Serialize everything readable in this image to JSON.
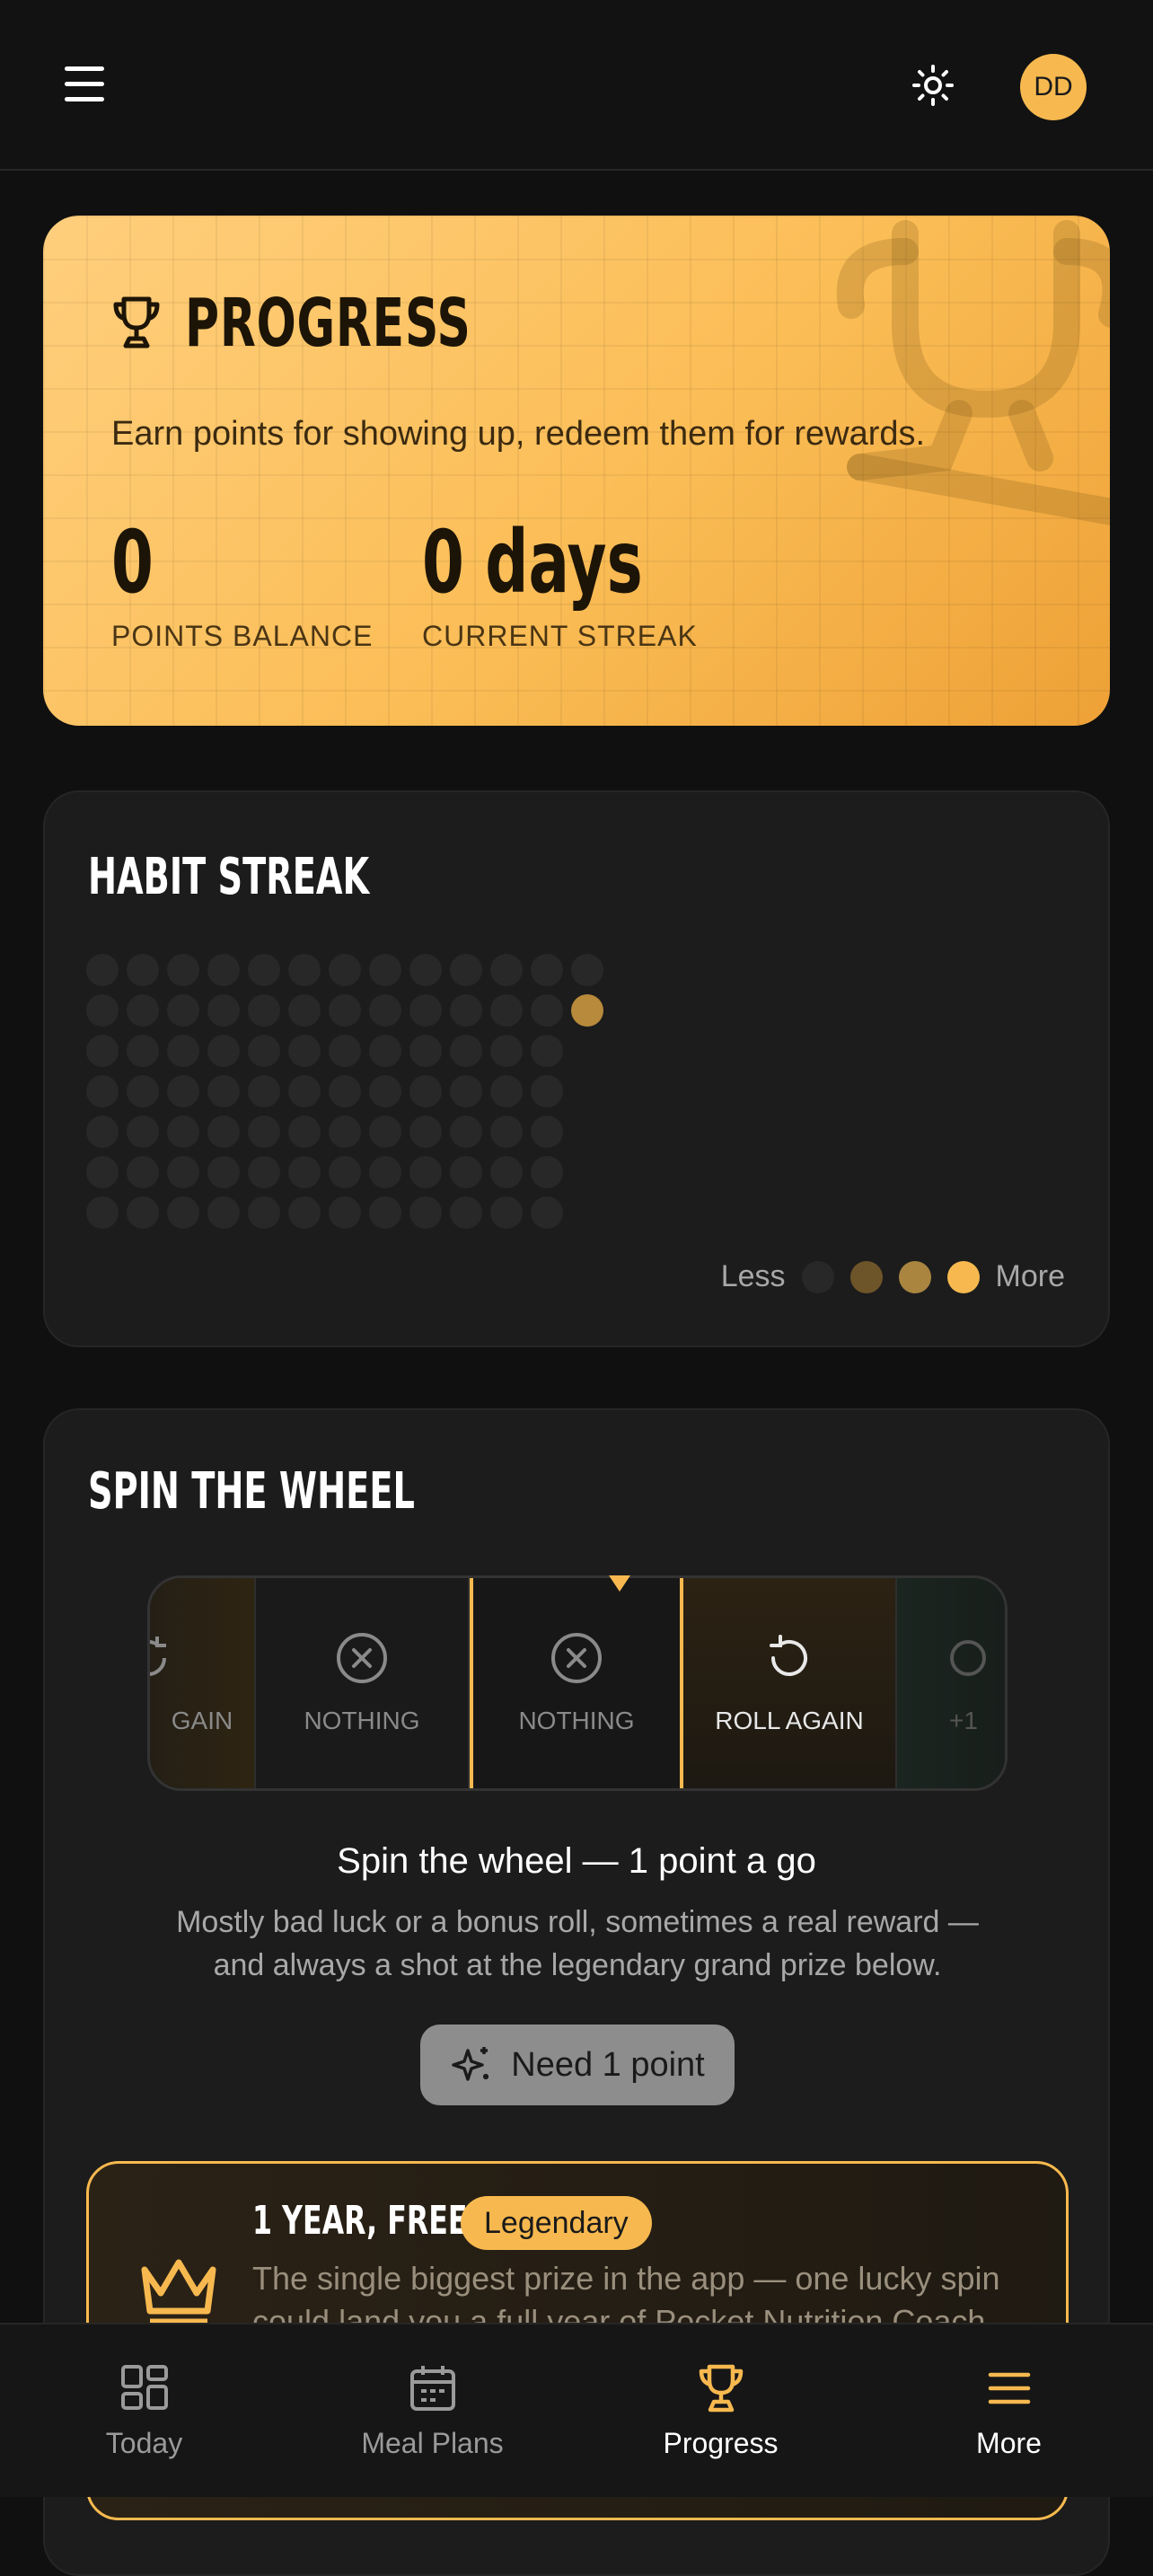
{
  "header": {
    "avatar_initials": "DD",
    "menu_icon": "hamburger-icon",
    "theme_icon": "sun-icon"
  },
  "progress": {
    "title": "PROGRESS",
    "subtitle": "Earn points for showing up, redeem them for rewards.",
    "points_value": "0",
    "points_label": "POINTS BALANCE",
    "streak_value": "0 days",
    "streak_label": "CURRENT STREAK"
  },
  "habit_streak": {
    "title": "HABIT STREAK",
    "legend_less": "Less",
    "legend_more": "More",
    "legend_colors": [
      "#282828",
      "#6e5529",
      "#a98540",
      "#f7b94f"
    ]
  },
  "spin": {
    "title": "SPIN THE WHEEL",
    "slots": [
      {
        "label": "GAIN",
        "icon": "refresh-icon"
      },
      {
        "label": "NOTHING",
        "icon": "x-circle-icon"
      },
      {
        "label": "NOTHING",
        "icon": "x-circle-icon"
      },
      {
        "label": "ROLL AGAIN",
        "icon": "refresh-icon"
      },
      {
        "label": "+1",
        "icon": "gift-icon"
      }
    ],
    "heading": "Spin the wheel — 1 point a go",
    "description": "Mostly bad luck or a bonus roll, sometimes a real reward — and always a shot at the legendary grand prize below.",
    "button_label": "Need 1 point"
  },
  "prize": {
    "title": "1 YEAR, FREE",
    "badge": "Legendary",
    "description": "The single biggest prize in the app — one lucky spin could land you a full year of Pocket Nutrition Coach, completely"
  },
  "nav": {
    "items": [
      {
        "label": "Today",
        "icon": "grid-icon"
      },
      {
        "label": "Meal Plans",
        "icon": "calendar-icon"
      },
      {
        "label": "Progress",
        "icon": "trophy-icon"
      },
      {
        "label": "More",
        "icon": "menu-icon"
      }
    ]
  }
}
